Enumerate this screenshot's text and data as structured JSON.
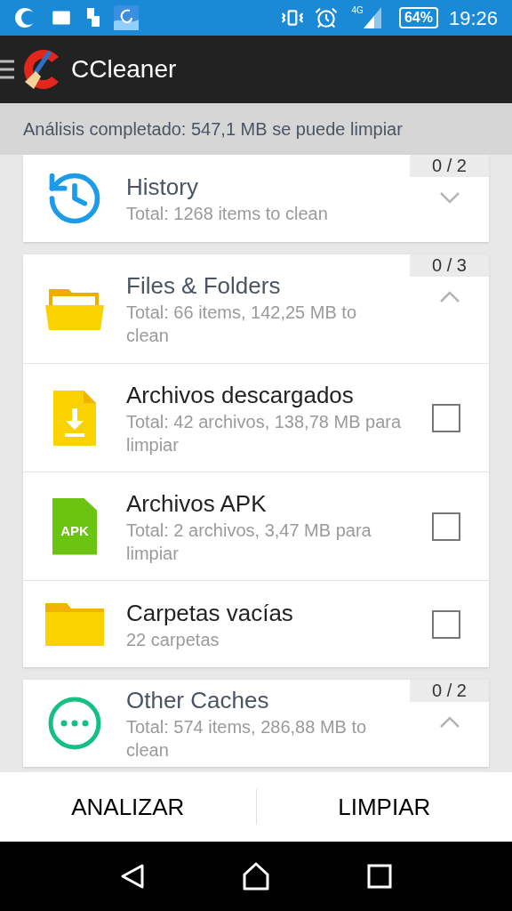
{
  "status_bar": {
    "network": "4G",
    "battery": "64%",
    "time": "19:26"
  },
  "app_bar": {
    "title": "CCleaner"
  },
  "summary": "Análisis completado: 547,1 MB se puede limpiar",
  "groups": [
    {
      "kind": "history",
      "title": "History",
      "subtitle": "Total: 1268 items to clean",
      "counter": "0 / 2",
      "expanded": false
    },
    {
      "kind": "files",
      "title": "Files & Folders",
      "subtitle": "Total: 66 items, 142,25 MB to clean",
      "counter": "0 / 3",
      "expanded": true,
      "items": [
        {
          "kind": "download",
          "title": "Archivos descargados",
          "subtitle": "Total: 42 archivos, 138,78 MB para limpiar",
          "checked": false
        },
        {
          "kind": "apk",
          "badge": "APK",
          "title": "Archivos APK",
          "subtitle": "Total: 2 archivos, 3,47 MB para limpiar",
          "checked": false
        },
        {
          "kind": "folder",
          "title": "Carpetas vacías",
          "subtitle": "22 carpetas",
          "checked": false
        }
      ]
    },
    {
      "kind": "caches",
      "title": "Other Caches",
      "subtitle": "Total: 574 items, 286,88 MB to clean",
      "counter": "0 / 2",
      "expanded": true
    }
  ],
  "buttons": [
    "ANALIZAR",
    "LIMPIAR"
  ]
}
